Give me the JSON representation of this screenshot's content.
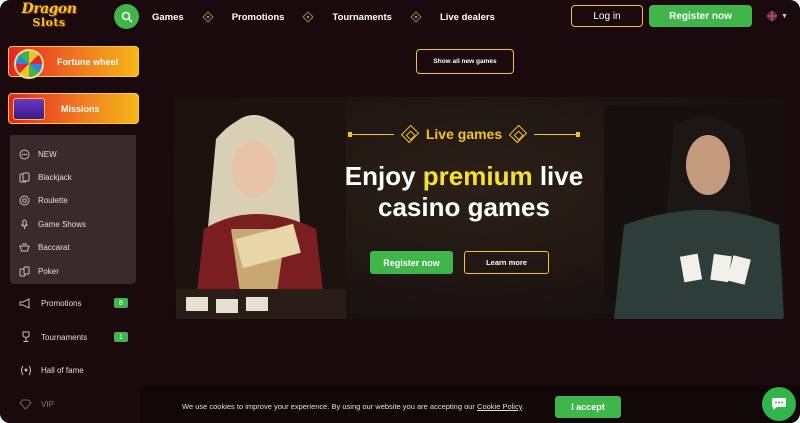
{
  "logo": {
    "line1": "Dragon",
    "line2": "Slots"
  },
  "header": {
    "nav": [
      "Games",
      "Promotions",
      "Tournaments",
      "Live dealers"
    ],
    "login_label": "Log in",
    "register_label": "Register now"
  },
  "sidebar": {
    "fortune_wheel": "Fortune wheel",
    "missions": "Missions",
    "submenu": [
      {
        "label": "NEW",
        "icon": "new-icon"
      },
      {
        "label": "Blackjack",
        "icon": "cards-icon"
      },
      {
        "label": "Roulette",
        "icon": "roulette-icon"
      },
      {
        "label": "Game Shows",
        "icon": "microphone-icon"
      },
      {
        "label": "Baccarat",
        "icon": "baccarat-icon"
      },
      {
        "label": "Poker",
        "icon": "poker-icon"
      }
    ],
    "promotions": {
      "label": "Promotions",
      "count": "8"
    },
    "tournaments": {
      "label": "Tournaments",
      "count": "1"
    },
    "hall_of_fame": "Hall of fame",
    "vip": "VIP"
  },
  "main": {
    "show_all_label": "Show all new games",
    "banner": {
      "tag": "Live games",
      "headline_pre": "Enjoy ",
      "headline_highlight": "premium",
      "headline_post": " live",
      "headline_line2": "casino games",
      "register_label": "Register now",
      "learn_more_label": "Learn more"
    }
  },
  "cookie": {
    "text": "We use cookies to improve your experience. By using our website you are accepting our ",
    "policy_link": "Cookie Policy",
    "period": ".",
    "accept_label": "I accept"
  },
  "colors": {
    "background": "#1a0a0d",
    "accent_green": "#3fb54a",
    "accent_gold": "#f5c226",
    "highlight_yellow": "#f5e32a"
  }
}
